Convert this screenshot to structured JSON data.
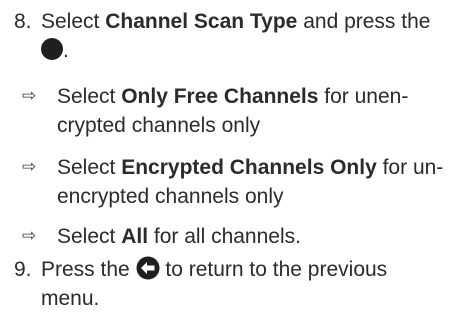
{
  "step8": {
    "number": "8.",
    "pre": "Select ",
    "bold": "Channel Scan Type",
    "post": " and press the",
    "end": ".",
    "icon": "ok-button-dot-icon"
  },
  "subitems": [
    {
      "pre": "Select ",
      "bold": "Only Free Channels",
      "post": " for unen-",
      "line2": "crypted channels only"
    },
    {
      "pre": "Select ",
      "bold": "Encrypted Channels Only",
      "post": " for un-",
      "line2": "encrypted channels only"
    },
    {
      "pre": "Select ",
      "bold": "All",
      "post": " for all channels."
    }
  ],
  "arrow_glyph": "⇨",
  "step9": {
    "number": "9.",
    "pre": "Press the ",
    "icon": "back-arrow-icon",
    "post": " to return to the previous",
    "line2": "menu."
  }
}
